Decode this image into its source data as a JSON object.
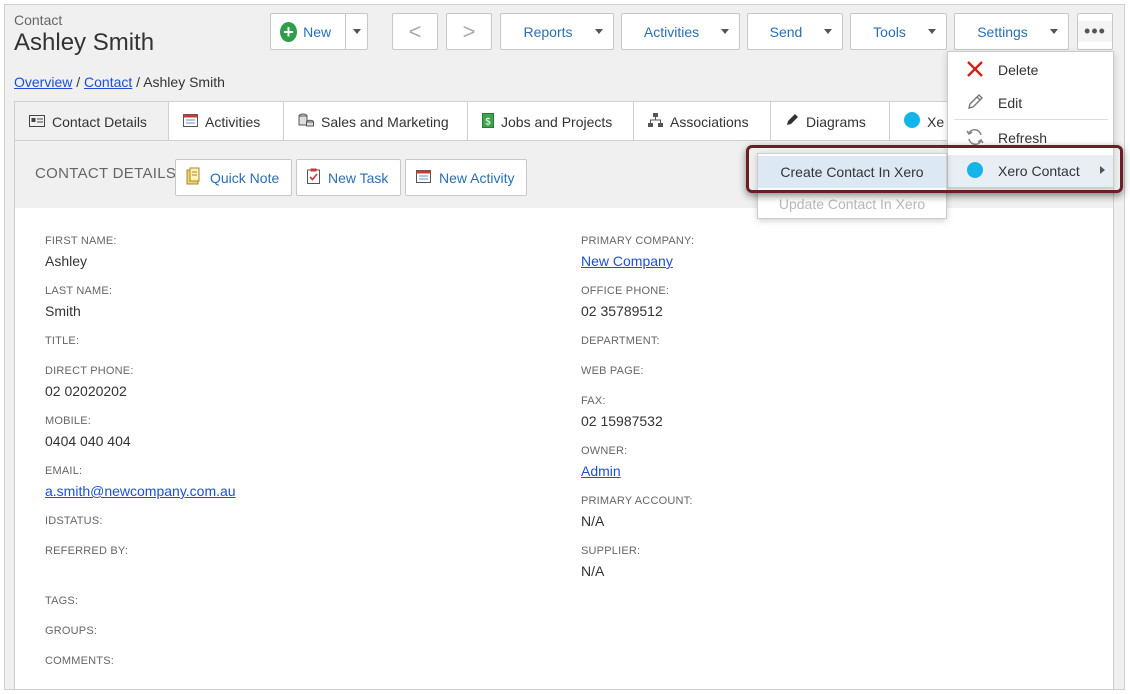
{
  "header": {
    "entity_type": "Contact",
    "record_name": "Ashley Smith"
  },
  "toolbar": {
    "new_label": "New",
    "reports_label": "Reports",
    "activities_label": "Activities",
    "send_label": "Send",
    "tools_label": "Tools",
    "settings_label": "Settings",
    "prev_glyph": "<",
    "next_glyph": ">",
    "more_glyph": "•••"
  },
  "breadcrumb": {
    "overview": "Overview",
    "sep1": " / ",
    "contact": "Contact",
    "sep2": " / ",
    "current": "Ashley Smith"
  },
  "tabs": [
    {
      "label": "Contact Details",
      "icon": "id-card-icon"
    },
    {
      "label": "Activities",
      "icon": "calendar-icon"
    },
    {
      "label": "Sales and Marketing",
      "icon": "coins-icon"
    },
    {
      "label": "Jobs and Projects",
      "icon": "dollar-doc-icon"
    },
    {
      "label": "Associations",
      "icon": "hierarchy-icon"
    },
    {
      "label": "Diagrams",
      "icon": "pencil-icon"
    },
    {
      "label": "Xe",
      "icon": "xero-icon"
    }
  ],
  "panel": {
    "title": "CONTACT DETAILS",
    "quick_note": "Quick Note",
    "new_task": "New Task",
    "new_activity": "New Activity"
  },
  "fields_left": [
    {
      "label": "FIRST NAME:",
      "value": "Ashley"
    },
    {
      "label": "LAST NAME:",
      "value": "Smith"
    },
    {
      "label": "TITLE:",
      "value": ""
    },
    {
      "label": "DIRECT PHONE:",
      "value": "02 02020202"
    },
    {
      "label": "MOBILE:",
      "value": "0404 040 404"
    },
    {
      "label": "EMAIL:",
      "value": "a.smith@newcompany.com.au"
    },
    {
      "label": "IDSTATUS:",
      "value": ""
    },
    {
      "label": "REFERRED BY:",
      "value": ""
    },
    {
      "label": "TAGS:",
      "value": ""
    },
    {
      "label": "GROUPS:",
      "value": ""
    },
    {
      "label": "COMMENTS:",
      "value": ""
    }
  ],
  "fields_right": [
    {
      "label": "PRIMARY COMPANY:",
      "value": "New Company"
    },
    {
      "label": "OFFICE PHONE:",
      "value": "02 35789512"
    },
    {
      "label": "DEPARTMENT:",
      "value": ""
    },
    {
      "label": "WEB PAGE:",
      "value": ""
    },
    {
      "label": "FAX:",
      "value": "02 15987532"
    },
    {
      "label": "OWNER:",
      "value": "Admin"
    },
    {
      "label": "PRIMARY ACCOUNT:",
      "value": "N/A"
    },
    {
      "label": "SUPPLIER:",
      "value": "N/A"
    }
  ],
  "more_menu": {
    "delete": "Delete",
    "edit": "Edit",
    "refresh": "Refresh",
    "xero_contact": "Xero Contact"
  },
  "xero_submenu": {
    "create": "Create Contact In Xero",
    "update": "Update Contact In Xero"
  },
  "colors": {
    "link": "#1a4fd6",
    "button_text": "#2a6fb6",
    "new_plus": "#2e9e4b",
    "delete_x": "#d0211c",
    "highlight_border": "#6b1f24",
    "xero_blue": "#13b5ea",
    "submenu_hover": "#dde8f5"
  }
}
